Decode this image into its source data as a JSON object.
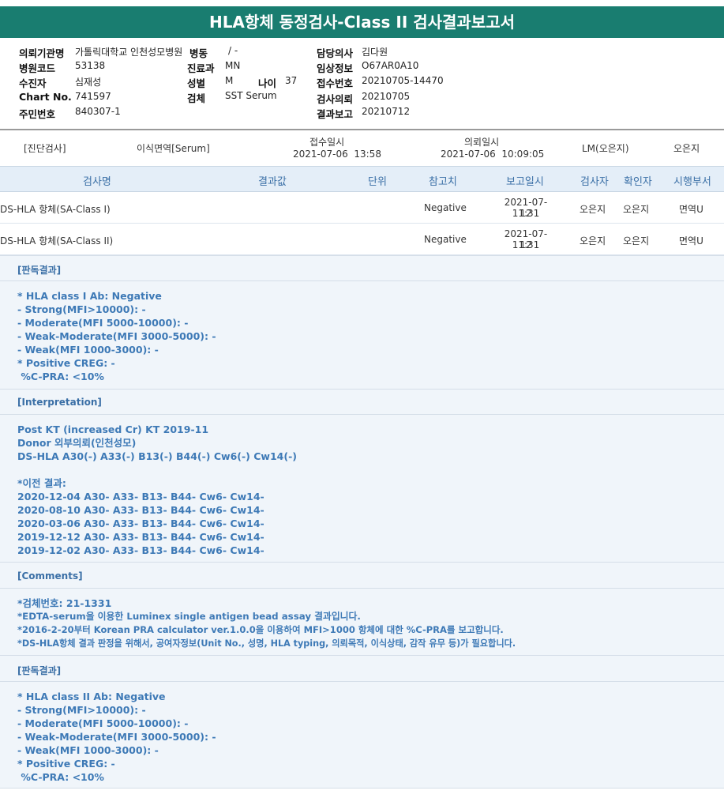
{
  "title": "HLA항체 동정검사-Class II 검사결과보고서",
  "info": {
    "hospital_label": "의뢰기관명",
    "hospital_value": "가톨릭대학교 인천성모병원",
    "ward_label": "병동",
    "ward_value": "/ -",
    "doctor_label": "담당의사",
    "doctor_value": "김다원",
    "hospcode_label": "병원코드",
    "hospcode_value": "53138",
    "dept_label": "진료과",
    "dept_value": "MN",
    "clinical_label": "임상정보",
    "clinical_value": "O67AR0A10",
    "patient_label": "수진자",
    "patient_value": "심재성",
    "sex_label": "성별",
    "sex_value": "M",
    "age_label": "나이",
    "age_value": "37",
    "receipt_label": "접수번호",
    "receipt_value": "20210705-14470",
    "chart_label": "Chart No.",
    "chart_value": "741597",
    "specimen_label": "검체",
    "specimen_value": "SST Serum",
    "request_label": "검사의뢰",
    "request_value": "20210705",
    "id_label": "주민번호",
    "id_value": "840307-1",
    "report_label": "결과보고",
    "report_value": "20210712"
  },
  "diagnosis": {
    "label": "[진단검사]",
    "value": "이식면역[Serum]",
    "receipt_date_label": "접수일시",
    "receipt_date_value": "2021-07-06  13:58",
    "request_date_label": "의뢰일시",
    "request_date_value": "2021-07-06  10:09:05",
    "lm": "LM(오은지)",
    "person": "오은지"
  },
  "table": {
    "headers": [
      "검사명",
      "결과값",
      "단위",
      "참고치",
      "보고일시",
      "검사자",
      "확인자",
      "시행부서"
    ],
    "rows": [
      {
        "name": "DS-HLA 항체(SA-Class I)",
        "result": "",
        "unit": "",
        "ref": "Negative",
        "date": "2021-07-12",
        "time": "11:31",
        "tester": "오은지",
        "checker": "오은지",
        "dept": "면역U"
      },
      {
        "name": "DS-HLA 항체(SA-Class II)",
        "result": "",
        "unit": "",
        "ref": "Negative",
        "date": "2021-07-12",
        "time": "11:31",
        "tester": "오은지",
        "checker": "오은지",
        "dept": "면역U"
      }
    ]
  },
  "sections": {
    "s1": {
      "header": "[판독결과]",
      "lines": [
        "* HLA class I Ab: Negative",
        "- Strong(MFI>10000): -",
        "- Moderate(MFI 5000-10000): -",
        "- Weak-Moderate(MFI 3000-5000): -",
        "- Weak(MFI 1000-3000): -",
        "* Positive CREG: -",
        " %C-PRA: <10%"
      ]
    },
    "s2": {
      "header": "[Interpretation]",
      "lines": [
        "Post KT (increased Cr) KT 2019-11",
        "Donor 외부의뢰(인천성모)",
        "DS-HLA A30(-) A33(-) B13(-) B44(-) Cw6(-) Cw14(-)",
        "",
        "*이전 결과:",
        "2020-12-04 A30- A33- B13- B44- Cw6- Cw14-",
        "2020-08-10 A30- A33- B13- B44- Cw6- Cw14-",
        "2020-03-06 A30- A33- B13- B44- Cw6- Cw14-",
        "2019-12-12 A30- A33- B13- B44- Cw6- Cw14-",
        "2019-12-02 A30- A33- B13- B44- Cw6- Cw14-"
      ]
    },
    "s3": {
      "header": "[Comments]",
      "lines": [
        "*검체번호: 21-1331",
        "*EDTA-serum을 이용한 Luminex single antigen bead assay 결과입니다.",
        "*2016-2-20부터 Korean PRA calculator ver.1.0.0을 이용하여 MFI>1000 항체에 대한 %C-PRA를 보고합니다.",
        "*DS-HLA항체 결과 판정을 위해서, 공여자정보(Unit No., 성명, HLA typing, 의뢰목적, 이식상태, 감작 유무 등)가 필요합니다."
      ]
    },
    "s4": {
      "header": "[판독결과]",
      "lines": [
        "* HLA class II Ab: Negative",
        "- Strong(MFI>10000): -",
        "- Moderate(MFI 5000-10000): -",
        "- Weak-Moderate(MFI 3000-5000): -",
        "- Weak(MFI 1000-3000): -",
        "* Positive CREG: -",
        " %C-PRA: <10%"
      ]
    }
  },
  "colors": {
    "title_bar": "#197d70",
    "header_blue": "#3a6fa6",
    "text_blue": "#3d79b6",
    "section_bg": "#f0f5fa"
  }
}
